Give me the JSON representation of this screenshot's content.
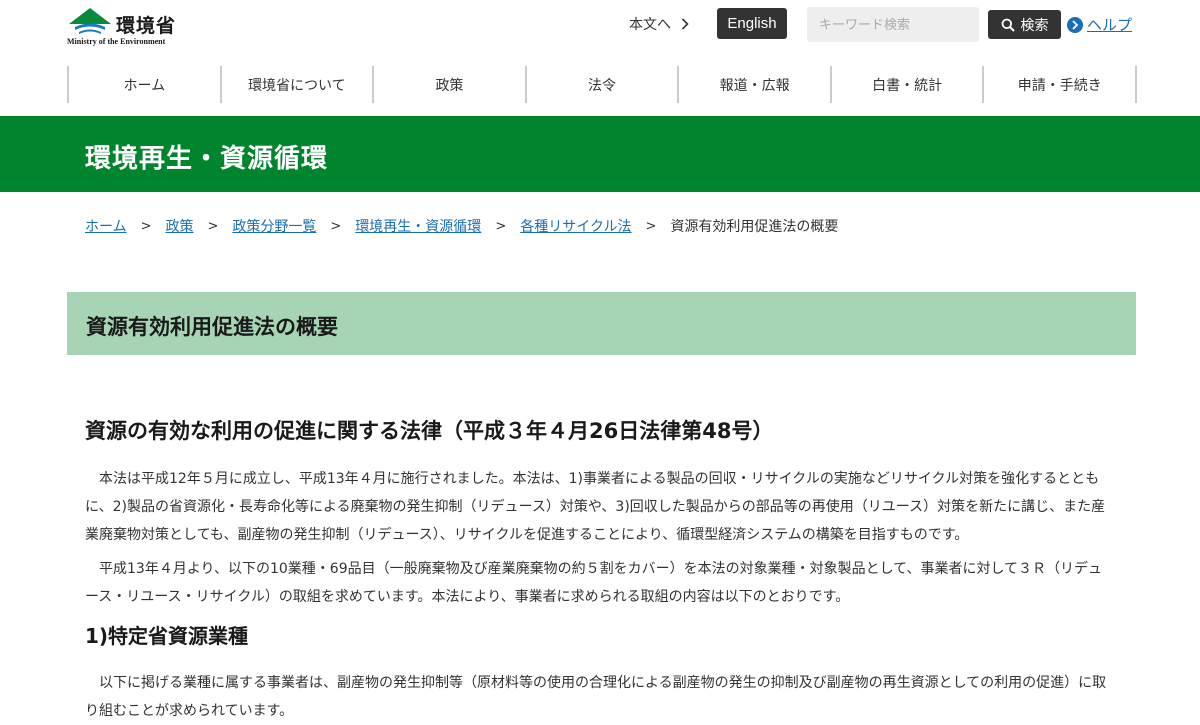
{
  "header": {
    "logo_name": "環境省",
    "logo_sub": "Ministry of the Environment",
    "skip_link": "本文へ",
    "english_label": "English",
    "search_placeholder": "キーワード検索",
    "search_button": "検索",
    "help_label": "ヘルプ"
  },
  "nav": {
    "items": [
      "ホーム",
      "環境省について",
      "政策",
      "法令",
      "報道・広報",
      "白書・統計",
      "申請・手続き"
    ]
  },
  "banner": {
    "title": "環境再生・資源循環"
  },
  "breadcrumb": {
    "links": [
      "ホーム",
      "政策",
      "政策分野一覧",
      "環境再生・資源循環",
      "各種リサイクル法"
    ],
    "separator": ">",
    "current": "資源有効利用促進法の概要"
  },
  "main": {
    "page_title": "資源有効利用促進法の概要",
    "law_heading": "資源の有効な利用の促進に関する法律（平成３年４月26日法律第48号）",
    "paragraph1": "本法は平成12年５月に成立し、平成13年４月に施行されました。本法は、1)事業者による製品の回収・リサイクルの実施などリサイクル対策を強化するとともに、2)製品の省資源化・長寿命化等による廃棄物の発生抑制（リデュース）対策や、3)回収した製品からの部品等の再使用（リユース）対策を新たに講じ、また産業廃棄物対策としても、副産物の発生抑制（リデュース）、リサイクルを促進することにより、循環型経済システムの構築を目指すものです。",
    "paragraph2": "平成13年４月より、以下の10業種・69品目（一般廃棄物及び産業廃棄物の約５割をカバー）を本法の対象業種・対象製品として、事業者に対して３Ｒ（リデュース・リユース・リサイクル）の取組を求めています。本法により、事業者に求められる取組の内容は以下のとおりです。",
    "subheading1": "1)特定省資源業種",
    "paragraph3": "以下に掲げる業種に属する事業者は、副産物の発生抑制等（原材料等の使用の合理化による副産物の発生の抑制及び副産物の再生資源としての利用の促進）に取り組むことが求められています。"
  },
  "colors": {
    "brand_green": "#00852e",
    "title_box_green": "#a6d4b4",
    "link_blue": "#1a6fb4",
    "dark_button": "#333333"
  },
  "icons": [
    "ministry-logo-icon",
    "chevron-right-icon",
    "search-icon",
    "help-arrow-icon"
  ]
}
